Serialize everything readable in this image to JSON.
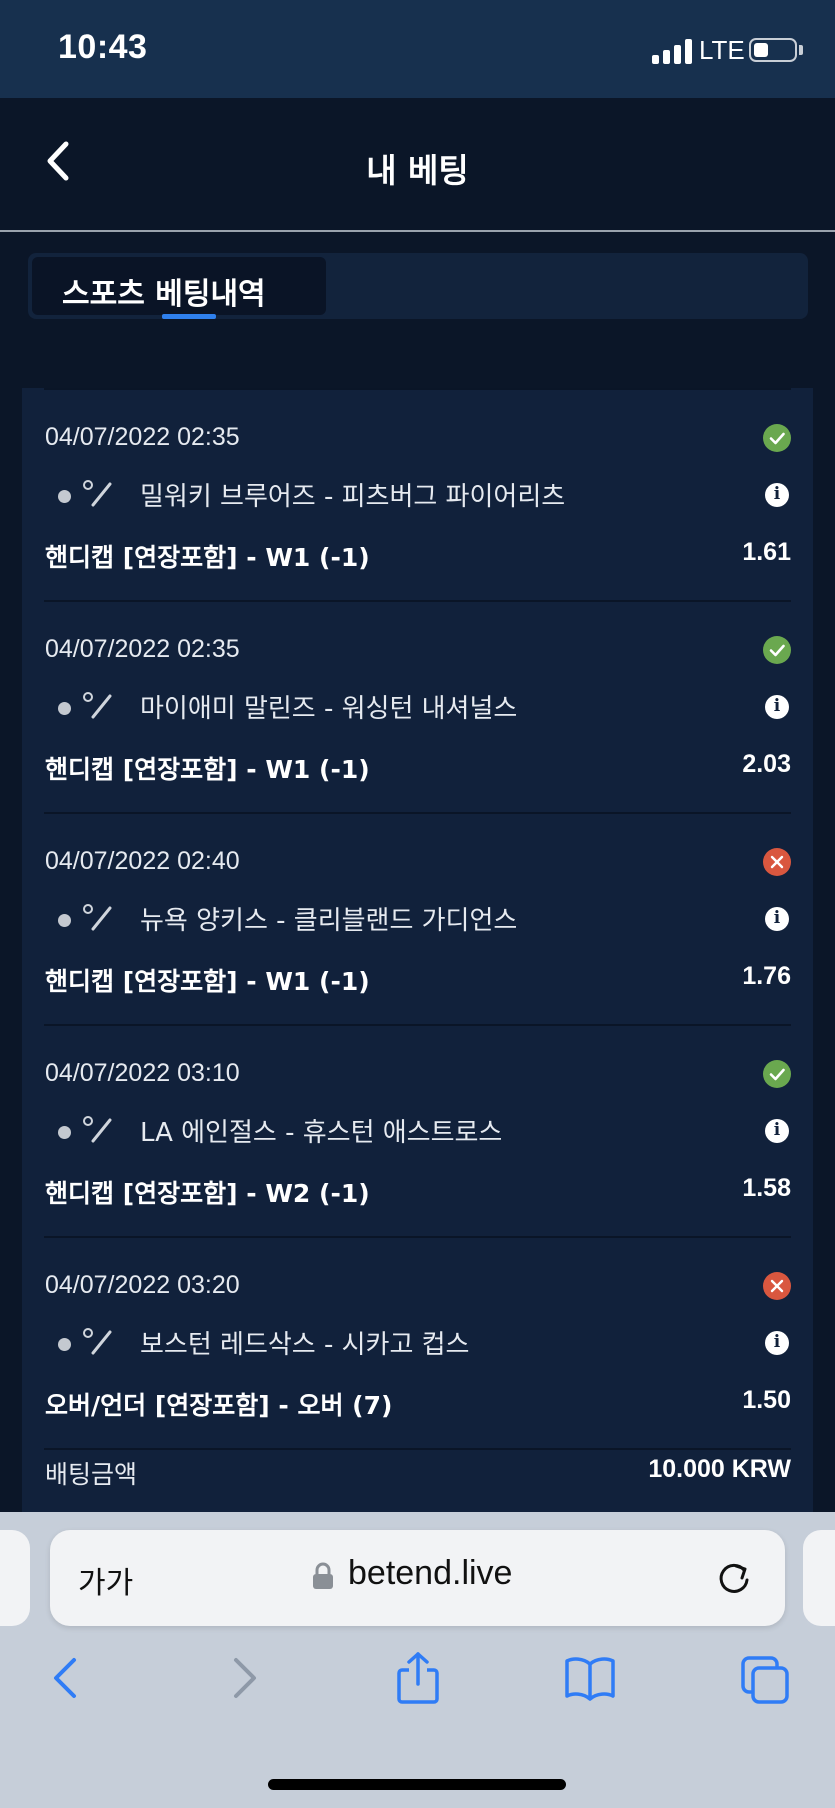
{
  "status_bar": {
    "time": "10:43",
    "network": "LTE"
  },
  "header": {
    "title": "내 베팅",
    "back_icon": "chevron-left-icon"
  },
  "tabs": [
    {
      "label": "스포츠 베팅내역",
      "active": true
    }
  ],
  "bets": [
    {
      "date": "04/07/2022 02:35",
      "status": "won",
      "match": "밀워키 브루어즈 - 피츠버그 파이어리츠",
      "market": "핸디캡 [연장포함] - W1 (-1)",
      "odds": "1.61"
    },
    {
      "date": "04/07/2022 02:35",
      "status": "won",
      "match": "마이애미 말린즈 - 워싱턴 내셔널스",
      "market": "핸디캡 [연장포함] - W1 (-1)",
      "odds": "2.03"
    },
    {
      "date": "04/07/2022 02:40",
      "status": "lost",
      "match": "뉴욕 양키스 - 클리블랜드 가디언스",
      "market": "핸디캡 [연장포함] - W1 (-1)",
      "odds": "1.76"
    },
    {
      "date": "04/07/2022 03:10",
      "status": "won",
      "match": "LA 에인절스 - 휴스턴 애스트로스",
      "market": "핸디캡 [연장포함] - W2 (-1)",
      "odds": "1.58"
    },
    {
      "date": "04/07/2022 03:20",
      "status": "lost",
      "match": "보스턴 레드삭스 - 시카고 컵스",
      "market": "오버/언더 [연장포함] - 오버 (7)",
      "odds": "1.50"
    }
  ],
  "summary": {
    "stake_label": "배팅금액",
    "stake_value": "10.000 KRW"
  },
  "browser": {
    "text_size_label": "가가",
    "url": "betend.live"
  },
  "colors": {
    "won": "#6aa84f",
    "lost": "#d9573f",
    "accent": "#2f80ed",
    "panel": "#11213b"
  }
}
